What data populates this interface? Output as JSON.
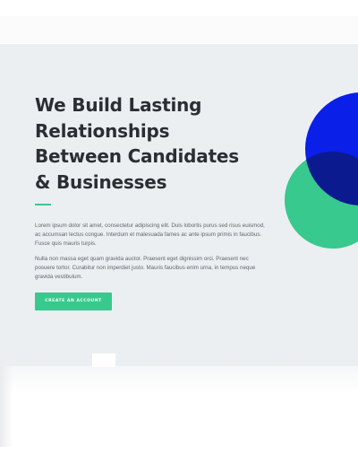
{
  "hero": {
    "headline_lines": [
      "We Build Lasting",
      "Relationships",
      "Between Candidates",
      "& Businesses"
    ],
    "paragraph_1": "Lorem ipsum dolor sit amet, consectetur adipiscing elit. Duis lobortis purus sed risus euismod, ac accumsan lectus congue. Interdum et malesuada fames ac ante ipsum primis in faucibus. Fusce quis mauris turpis.",
    "paragraph_2": "Nulla non massa eget quam gravida auctor. Praesent eget dignissim orci. Praesent nec posuere tortor. Curabitur non imperdiet justo. Mauris faucibus enim urna, in tempus neque gravida vestibulum.",
    "cta_label": "CREATE AN ACCOUNT"
  },
  "colors": {
    "accent_green": "#37c98d",
    "circle_blue": "#0a1fe8",
    "circle_overlap": "#0b1a8f",
    "hero_background": "#eceff1",
    "heading_text": "#2b2e33"
  }
}
